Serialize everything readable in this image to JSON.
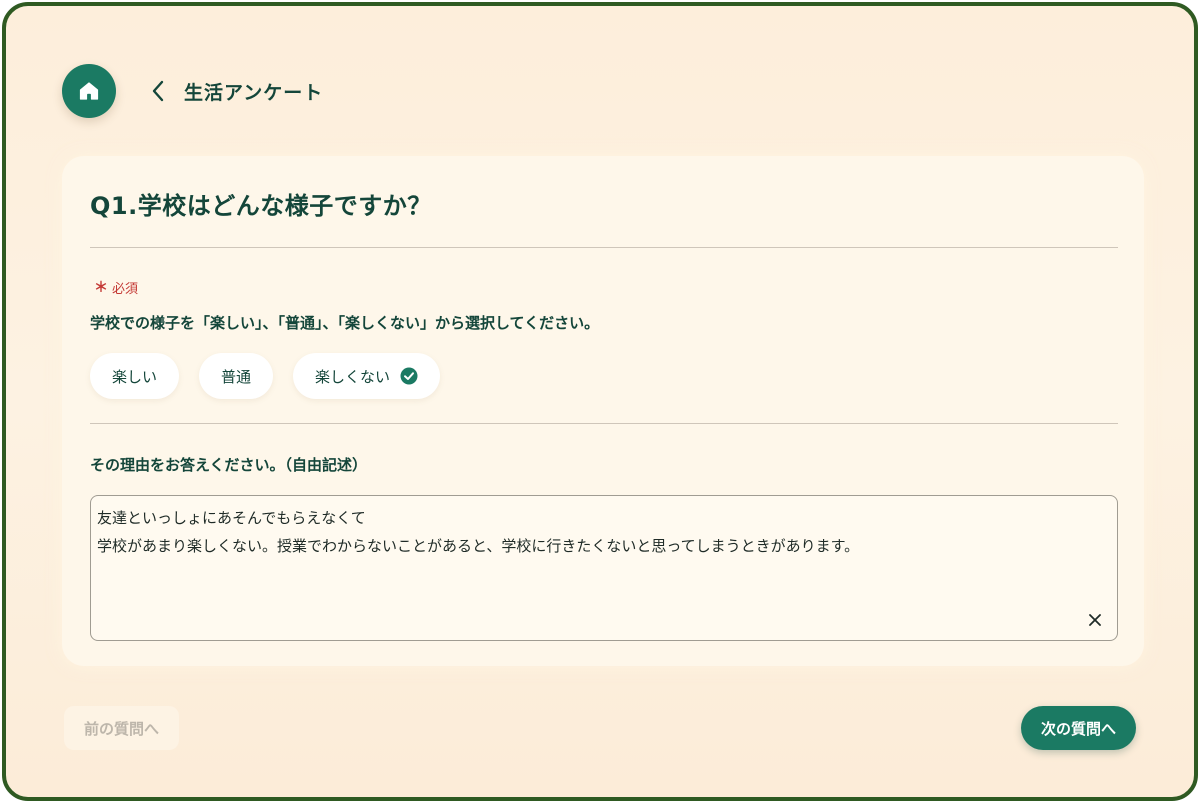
{
  "header": {
    "home_icon": "home-icon",
    "back_icon": "chevron-left-icon",
    "title": "生活アンケート"
  },
  "question": {
    "title": "Q1.学校はどんな様子ですか？",
    "required_mark": "＊",
    "required_label": "必須",
    "instruction": "学校での様子を「楽しい」、「普通」、「楽しくない」から選択してください。",
    "options": [
      {
        "label": "楽しい",
        "selected": false
      },
      {
        "label": "普通",
        "selected": false
      },
      {
        "label": "楽しくない",
        "selected": true
      }
    ],
    "reason_label": "その理由をお答えください。（自由記述）",
    "reason_lines": [
      "友達といっしょにあそんでもらえなくて",
      "学校があまり楽しくない。授業でわからないことがあると、学校に行きたくないと思ってしまうときがあります。"
    ]
  },
  "footer": {
    "prev_label": "前の質問へ",
    "next_label": "次の質問へ"
  },
  "colors": {
    "primary": "#1b7a63",
    "text": "#14463a",
    "required": "#c43a36",
    "frame_border": "#2f5a22",
    "background": "#fdeedb"
  }
}
